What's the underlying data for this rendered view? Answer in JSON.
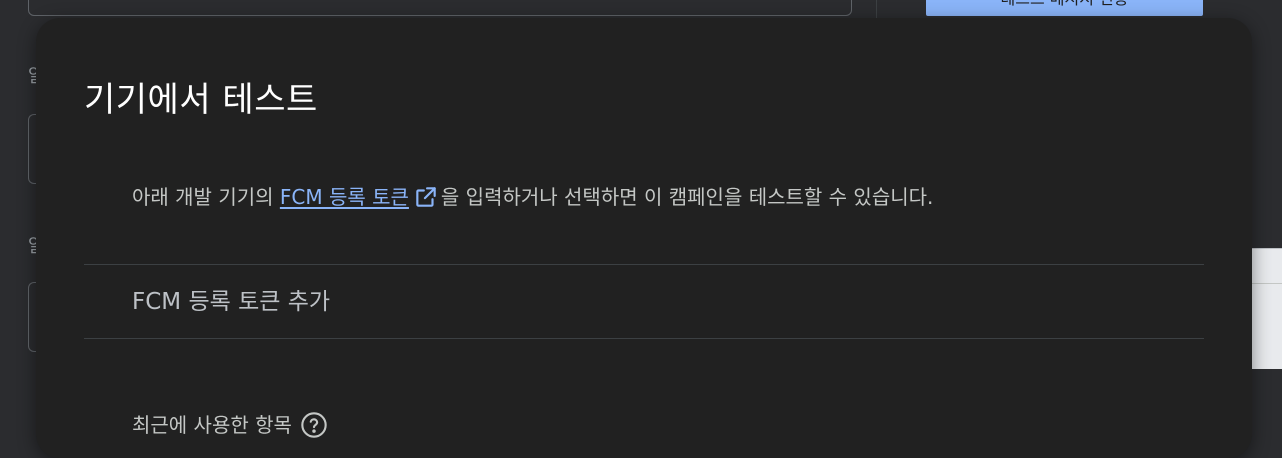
{
  "background": {
    "top_button_label": "테스트 메시지 전송",
    "side_label_1": "알",
    "side_label_2": "알"
  },
  "dialog": {
    "title": "기기에서 테스트",
    "description": {
      "before": "아래 개발 기기의 ",
      "link": "FCM 등록 토큰",
      "after": "을 입력하거나 선택하면 이 캠페인을 테스트할 수 있습니다."
    },
    "token_input": {
      "placeholder": "FCM 등록 토큰 추가",
      "value": ""
    },
    "recent_label": "최근에 사용한 항목"
  },
  "colors": {
    "dialog_bg": "#212121",
    "link": "#8ab4f8",
    "primary_button": "#8ab4f8"
  },
  "icons": {
    "external_link": "open-in-new-icon",
    "help": "help-circle-icon"
  }
}
